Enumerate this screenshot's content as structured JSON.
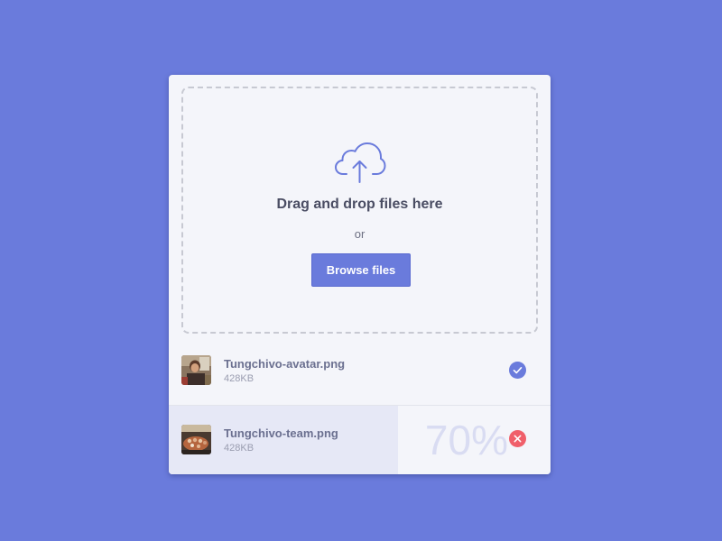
{
  "colors": {
    "background": "#6a7bdc",
    "accent": "#6a7bdc",
    "error": "#f05f6a",
    "card": "#f4f5fa"
  },
  "dropzone": {
    "icon": "cloud-upload-icon",
    "title": "Drag and drop files here",
    "or_text": "or",
    "browse_label": "Browse files"
  },
  "files": [
    {
      "name": "Tungchivo-avatar.png",
      "size": "428KB",
      "status": "complete",
      "status_icon": "check-circle-icon"
    },
    {
      "name": "Tungchivo-team.png",
      "size": "428KB",
      "status": "uploading",
      "progress_text": "70%",
      "progress": 0.6,
      "status_icon": "cancel-circle-icon"
    }
  ]
}
